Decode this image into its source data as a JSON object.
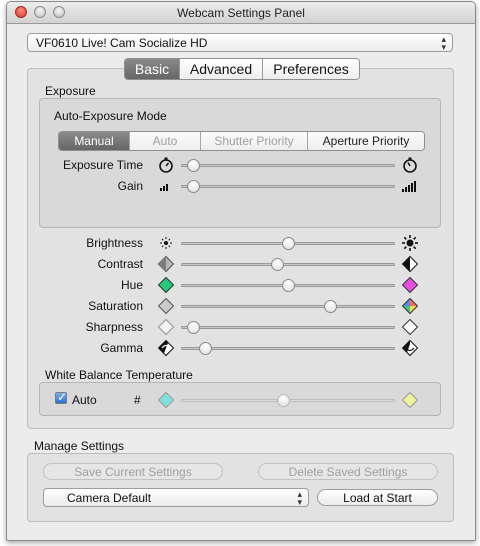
{
  "window": {
    "title": "Webcam Settings Panel"
  },
  "camera_select": {
    "value": "VF0610 Live! Cam Socialize HD"
  },
  "tabs": [
    {
      "label": "Basic",
      "selected": true
    },
    {
      "label": "Advanced",
      "selected": false
    },
    {
      "label": "Preferences",
      "selected": false
    }
  ],
  "exposure": {
    "heading": "Exposure",
    "auto_exposure_label": "Auto-Exposure Mode",
    "modes": [
      {
        "label": "Manual",
        "selected": true,
        "enabled": true
      },
      {
        "label": "Auto",
        "selected": false,
        "enabled": false
      },
      {
        "label": "Shutter Priority",
        "selected": false,
        "enabled": false
      },
      {
        "label": "Aperture Priority",
        "selected": false,
        "enabled": true
      }
    ],
    "sliders": [
      {
        "label": "Exposure Time",
        "value": 0.03,
        "min_icon": "stopwatch-icon",
        "max_icon": "stopwatch-icon"
      },
      {
        "label": "Gain",
        "value": 0.03,
        "min_icon": "signal-low-icon",
        "max_icon": "signal-high-icon"
      }
    ]
  },
  "image_controls": [
    {
      "label": "Brightness",
      "value": 0.5,
      "min_icon": "sun-small-icon",
      "max_icon": "sun-large-icon"
    },
    {
      "label": "Contrast",
      "value": 0.45,
      "min_icon": "contrast-low-icon",
      "max_icon": "contrast-high-icon"
    },
    {
      "label": "Hue",
      "value": 0.5,
      "min_icon": "hue-green-icon",
      "max_icon": "hue-magenta-icon"
    },
    {
      "label": "Saturation",
      "value": 0.71,
      "min_icon": "saturation-gray-icon",
      "max_icon": "saturation-color-icon"
    },
    {
      "label": "Sharpness",
      "value": 0.03,
      "min_icon": "sharpness-soft-icon",
      "max_icon": "sharpness-sharp-icon"
    },
    {
      "label": "Gamma",
      "value": 0.09,
      "min_icon": "gamma-low-icon",
      "max_icon": "gamma-high-icon"
    }
  ],
  "white_balance": {
    "heading": "White Balance Temperature",
    "auto_label": "Auto",
    "auto_checked": true,
    "value_symbol": "#",
    "value": 0.48,
    "min_icon": "wb-cyan-icon",
    "max_icon": "wb-yellow-icon"
  },
  "manage": {
    "heading": "Manage Settings",
    "save_button": "Save Current Settings",
    "delete_button": "Delete Saved Settings",
    "preset_value": "Camera Default",
    "load_button": "Load at Start"
  },
  "colors": {
    "hue_min": "#22c97a",
    "hue_max": "#e54fe0",
    "wb_min": "#7fe0e0",
    "wb_max": "#eef29a",
    "checkbox": "#2a6fd4"
  }
}
